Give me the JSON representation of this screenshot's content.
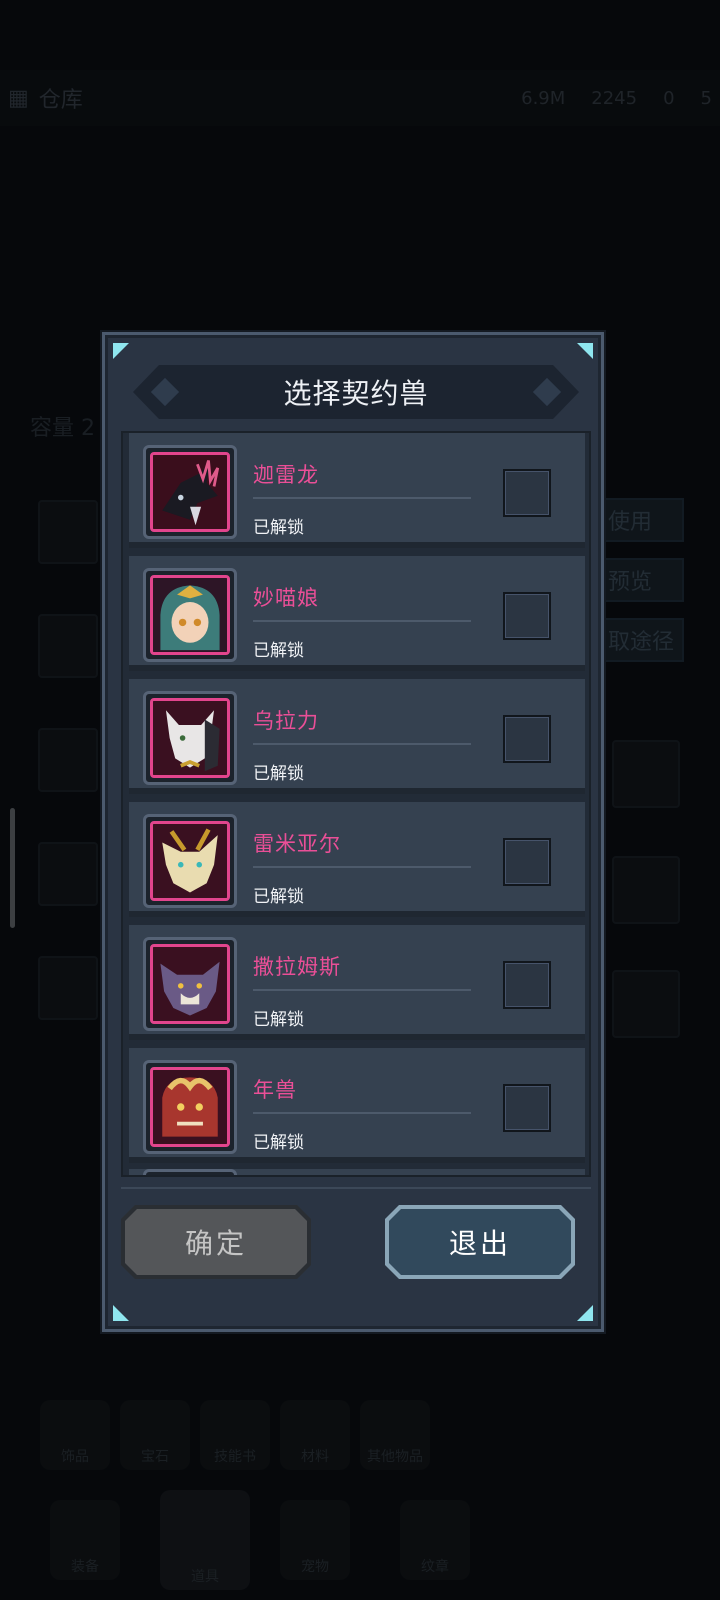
{
  "background": {
    "topbar": {
      "title": "仓库",
      "resources": [
        "6.9M",
        "2245",
        "0",
        "5"
      ]
    },
    "capacity_label": "容量 2",
    "side_buttons": [
      "使用",
      "预览",
      "取途径"
    ],
    "bottom_tabs": [
      "饰品",
      "宝石",
      "技能书",
      "材料",
      "其他物品"
    ],
    "nav_items": [
      "装备",
      "道具",
      "宠物",
      "纹章"
    ]
  },
  "dialog": {
    "title": "选择契约兽",
    "confirm_label": "确定",
    "exit_label": "退出",
    "items": [
      {
        "name": "迦雷龙",
        "status": "已解锁",
        "checked": false,
        "icon": "black-dragon-icon"
      },
      {
        "name": "妙喵娘",
        "status": "已解锁",
        "checked": false,
        "icon": "cat-girl-icon"
      },
      {
        "name": "乌拉力",
        "status": "已解锁",
        "checked": false,
        "icon": "white-beast-icon"
      },
      {
        "name": "雷米亚尔",
        "status": "已解锁",
        "checked": false,
        "icon": "golden-beast-icon"
      },
      {
        "name": "撒拉姆斯",
        "status": "已解锁",
        "checked": false,
        "icon": "purple-beast-icon"
      },
      {
        "name": "年兽",
        "status": "已解锁",
        "checked": false,
        "icon": "nian-beast-icon"
      }
    ]
  },
  "colors": {
    "name_text": "#ea4f97",
    "dialog_bg": "#2a3443",
    "row_bg": "#354150",
    "corner_accent": "#8fe6ef"
  }
}
